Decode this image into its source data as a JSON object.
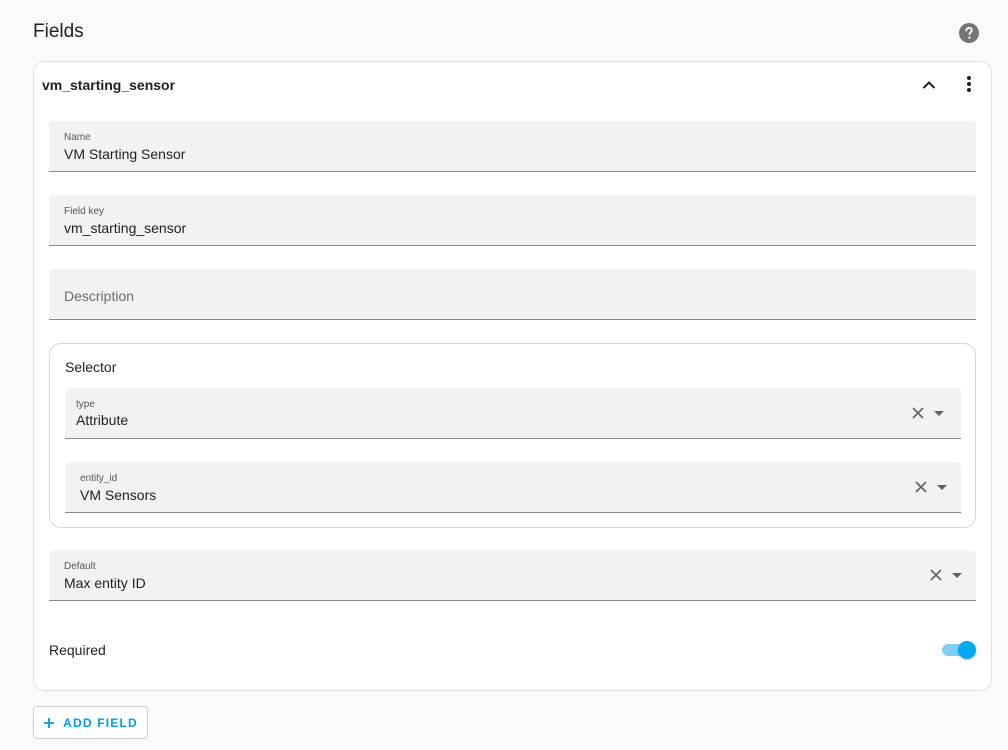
{
  "header": {
    "title": "Fields",
    "help_icon": "help-circle-icon"
  },
  "field_card": {
    "title": "vm_starting_sensor",
    "collapse_icon": "chevron-up-icon",
    "menu_icon": "dots-vertical-icon",
    "name": {
      "label": "Name",
      "value": "VM Starting Sensor"
    },
    "field_key": {
      "label": "Field key",
      "value": "vm_starting_sensor"
    },
    "description": {
      "placeholder": "Description"
    },
    "selector": {
      "label": "Selector",
      "type": {
        "label": "type",
        "value": "Attribute"
      },
      "entity_id": {
        "label": "entity_id",
        "value": "VM Sensors"
      }
    },
    "default": {
      "label": "Default",
      "value": "Max entity ID"
    },
    "required": {
      "label": "Required",
      "checked": true
    }
  },
  "add_field_button": {
    "label": "ADD FIELD",
    "icon": "plus-icon"
  },
  "colors": {
    "accent": "#03a9f4",
    "accent_light": "#7fcff5",
    "button_text": "#039be5",
    "field_bg": "#f2f2f2",
    "page_bg": "#fafafa"
  }
}
